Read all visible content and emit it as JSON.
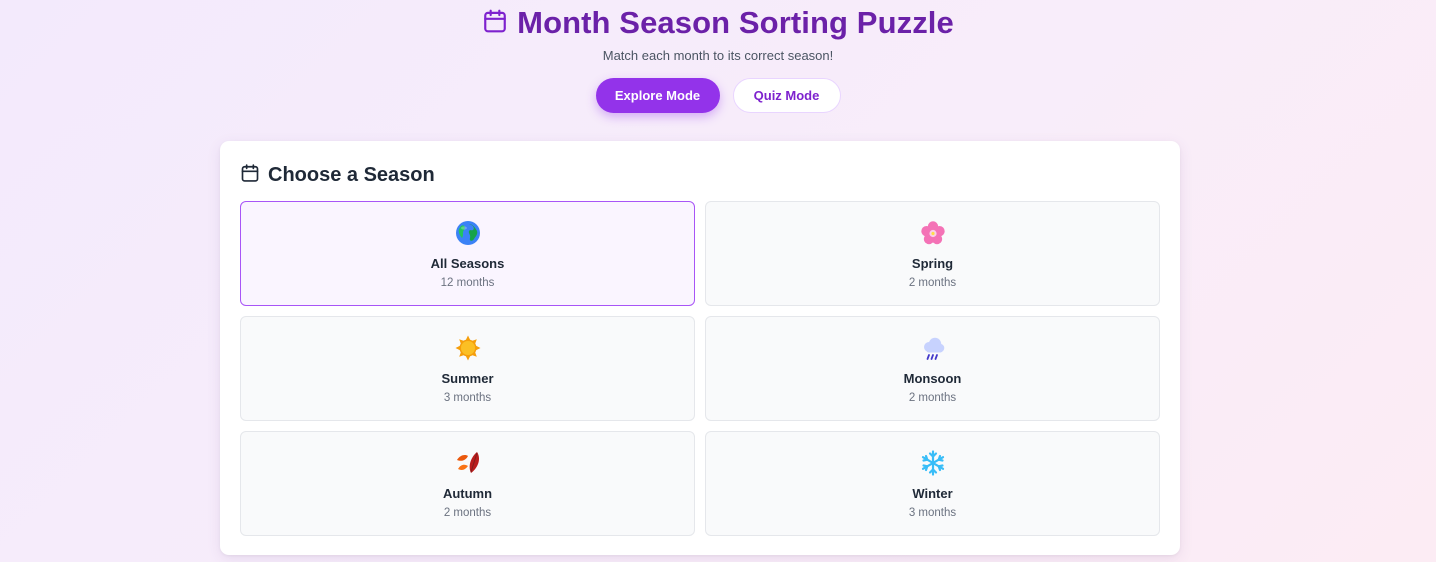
{
  "header": {
    "title": "Month Season Sorting Puzzle",
    "subtitle": "Match each month to its correct season!",
    "icon": "calendar-icon",
    "accent_color": "#6b21a8"
  },
  "modes": {
    "explore_label": "Explore Mode",
    "quiz_label": "Quiz Mode",
    "active": "Explore Mode"
  },
  "panel": {
    "title": "Choose a Season",
    "icon": "calendar-icon"
  },
  "seasons": [
    {
      "name": "All Seasons",
      "count": "12 months",
      "icon": "globe-icon",
      "selected": true
    },
    {
      "name": "Spring",
      "count": "2 months",
      "icon": "cherry-blossom-icon",
      "selected": false
    },
    {
      "name": "Summer",
      "count": "3 months",
      "icon": "sun-icon",
      "selected": false
    },
    {
      "name": "Monsoon",
      "count": "2 months",
      "icon": "rain-cloud-icon",
      "selected": false
    },
    {
      "name": "Autumn",
      "count": "2 months",
      "icon": "fallen-leaf-icon",
      "selected": false
    },
    {
      "name": "Winter",
      "count": "3 months",
      "icon": "snowflake-icon",
      "selected": false
    }
  ]
}
